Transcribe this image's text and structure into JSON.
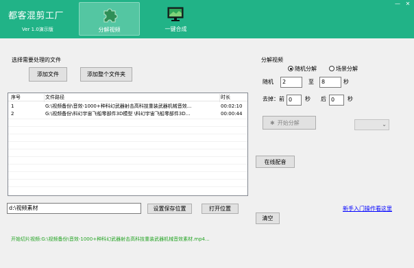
{
  "header": {
    "app_title": "都客混剪工厂",
    "version": "Ver 1.0演示版",
    "minimize_glyph": "—",
    "close_glyph": "✕",
    "tabs": [
      {
        "label": "分解视频",
        "icon": "puzzle-icon",
        "active": true
      },
      {
        "label": "一键合成",
        "icon": "monitor-icon",
        "active": false
      }
    ]
  },
  "colors": {
    "header_bg": "#21b387",
    "active_tab": "#54c6a2",
    "status_text": "#22a322",
    "link": "#0000ff"
  },
  "files": {
    "group_title": "选择需要处理的文件",
    "add_file_label": "添加文件",
    "add_folder_label": "添加整个文件夹",
    "columns": [
      "序号",
      "文件路径",
      "时长"
    ],
    "rows": [
      {
        "index": "1",
        "path": "G:\\视频备份\\音效-1000+种科幻武器射击高科技重装武器机械音效...",
        "duration": "00:02:10"
      },
      {
        "index": "2",
        "path": "G:\\视频备份\\科幻宇宙飞船零部件3D模型 \\科幻宇宙飞船零部件3D...",
        "duration": "00:00:44"
      }
    ]
  },
  "output": {
    "path_value": "d:\\视频素材",
    "set_location_label": "设置保存位置",
    "open_location_label": "打开位置"
  },
  "split": {
    "group_title": "分解视频",
    "radio_random": "随机分解",
    "radio_scene": "场景分解",
    "random_label": "随机",
    "from_value": "2",
    "to_label": "至",
    "to_value": "8",
    "sec_unit": "秒",
    "trim_label": "去掉：前",
    "trim_front_value": "0",
    "trim_back_label": "后",
    "trim_back_value": "0",
    "start_label": "开始分解",
    "start_icon": "gear-icon",
    "dropdown_value": ""
  },
  "online_dub_label": "在线配音",
  "tutorial_link": "新手入门操作看这里",
  "clear_label": "清空",
  "status_text": "开始切片视频:G:\\视频备份\\音效-1000+种科幻武器射击高科技重装武器机械音效素材.mp4..."
}
